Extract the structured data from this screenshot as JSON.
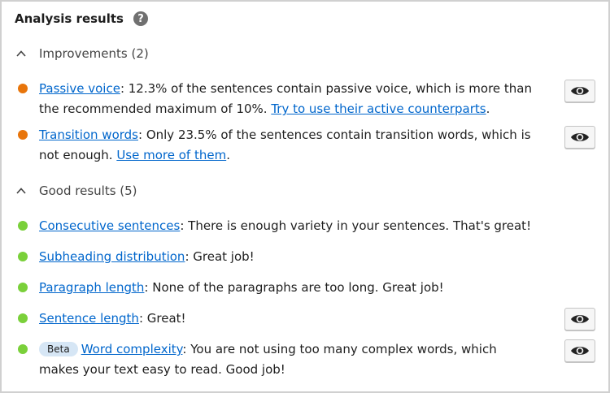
{
  "header": {
    "title": "Analysis results",
    "help_glyph": "?"
  },
  "colors": {
    "orange": "#e8750b",
    "green": "#7ad03a",
    "link": "#0066cc"
  },
  "improvements": {
    "label": "Improvements (2)",
    "items": [
      {
        "link": "Passive voice",
        "text": ": 12.3% of the sentences contain passive voice, which is more than the recommended maximum of 10%. ",
        "action": "Try to use their active counterparts",
        "after": "."
      },
      {
        "link": "Transition words",
        "text": ": Only 23.5% of the sentences contain transition words, which is not enough. ",
        "action": "Use more of them",
        "after": "."
      }
    ]
  },
  "good": {
    "label": "Good results (5)",
    "items": [
      {
        "link": "Consecutive sentences",
        "text": ": There is enough variety in your sentences. That's great!"
      },
      {
        "link": "Subheading distribution",
        "text": ": Great job!"
      },
      {
        "link": "Paragraph length",
        "text": ": None of the paragraphs are too long. Great job!"
      },
      {
        "link": "Sentence length",
        "text": ": Great!"
      },
      {
        "badge": "Beta",
        "link": "Word complexity",
        "text": ": You are not using too many complex words, which makes your text easy to read. Good job!"
      }
    ]
  }
}
